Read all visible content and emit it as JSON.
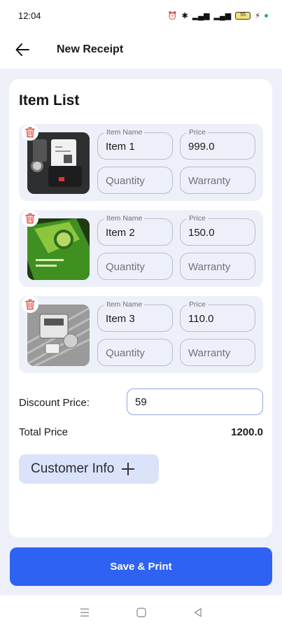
{
  "status_bar": {
    "time": "12:04",
    "battery": "55"
  },
  "app_bar": {
    "title": "New Receipt"
  },
  "item_list": {
    "title": "Item List",
    "items": [
      {
        "name_label": "Item Name",
        "name": "Item 1",
        "price_label": "Price",
        "price": "999.0",
        "quantity_placeholder": "Quantity",
        "warranty_placeholder": "Warranty",
        "photo": "receipt-printer-photo"
      },
      {
        "name_label": "Item Name",
        "name": "Item 2",
        "price_label": "Price",
        "price": "150.0",
        "quantity_placeholder": "Quantity",
        "warranty_placeholder": "Warranty",
        "photo": "green-card-photo"
      },
      {
        "name_label": "Item Name",
        "name": "Item 3",
        "price_label": "Price",
        "price": "110.0",
        "quantity_placeholder": "Quantity",
        "warranty_placeholder": "Warranty",
        "photo": "metal-device-photo"
      }
    ]
  },
  "discount": {
    "label": "Discount Price:",
    "value": "59"
  },
  "total": {
    "label": "Total Price",
    "value": "1200.0"
  },
  "customer_info": {
    "label": "Customer Info"
  },
  "save_button": {
    "label": "Save & Print"
  },
  "colors": {
    "accent": "#2d62f2",
    "background": "#eef0f9",
    "customer_button": "#dbe3fb",
    "delete": "#e0443b"
  }
}
